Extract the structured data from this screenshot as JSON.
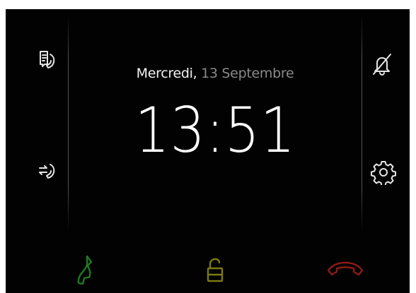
{
  "date": {
    "weekday": "Mercredi,",
    "day_month": "13 Septembre"
  },
  "clock": {
    "time": "13:51"
  },
  "icons": {
    "left_top": "call-log-icon",
    "left_bottom": "call-forward-icon",
    "right_top": "bell-muted-icon",
    "right_bottom": "settings-gear-icon",
    "bottom_left": "answer-call-icon",
    "bottom_center": "unlock-door-icon",
    "bottom_right": "hang-up-icon"
  },
  "colors": {
    "background": "#020202",
    "text_primary": "#f2f2f2",
    "text_secondary": "#8a8a8a",
    "answer_green": "#1f7a22",
    "unlock_yellow": "#7c7a12",
    "hangup_red": "#8c1a14"
  }
}
